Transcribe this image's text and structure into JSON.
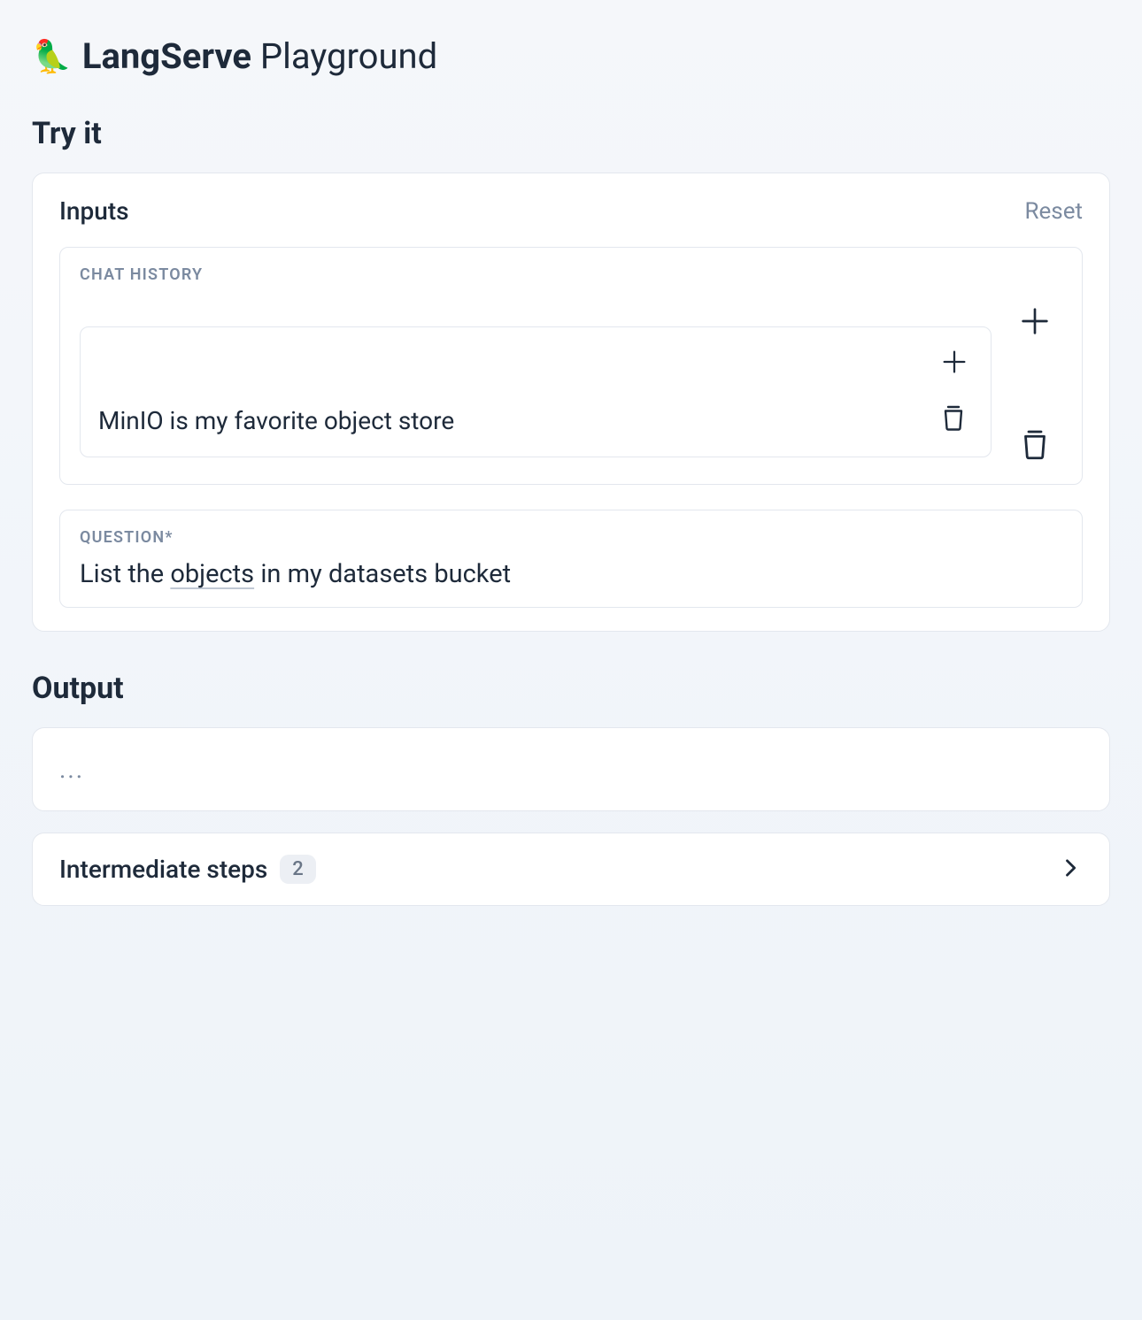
{
  "header": {
    "emoji": "🦜",
    "title_bold": "LangServe",
    "title_light": "Playground"
  },
  "sections": {
    "try_it": "Try it",
    "output": "Output"
  },
  "inputs": {
    "title": "Inputs",
    "reset_label": "Reset",
    "chat_history": {
      "label": "CHAT HISTORY",
      "messages": [
        {
          "text": "MinIO is my favorite object store"
        }
      ]
    },
    "question": {
      "label": "QUESTION*",
      "value_pre": "List the ",
      "value_underlined": "objects",
      "value_post": " in my datasets bucket"
    }
  },
  "output": {
    "placeholder": "..."
  },
  "intermediate_steps": {
    "label": "Intermediate steps",
    "count": "2"
  }
}
